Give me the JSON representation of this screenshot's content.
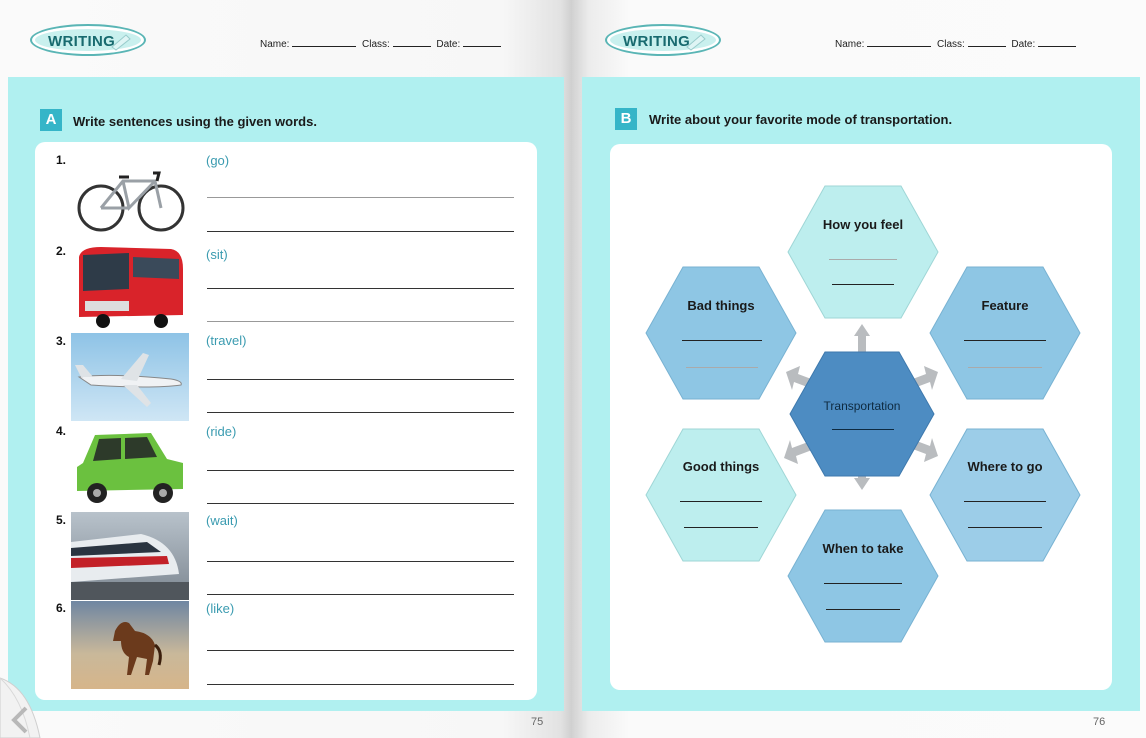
{
  "left_page": {
    "logo": "WRITING",
    "header": {
      "name_label": "Name:",
      "class_label": "Class:",
      "date_label": "Date:"
    },
    "section": {
      "letter": "A",
      "title": "Write sentences using the given words.",
      "items": [
        {
          "num": "1.",
          "word": "(go)",
          "image": "bicycle"
        },
        {
          "num": "2.",
          "word": "(sit)",
          "image": "bus"
        },
        {
          "num": "3.",
          "word": "(travel)",
          "image": "airplane"
        },
        {
          "num": "4.",
          "word": "(ride)",
          "image": "car"
        },
        {
          "num": "5.",
          "word": "(wait)",
          "image": "train"
        },
        {
          "num": "6.",
          "word": "(like)",
          "image": "horse"
        }
      ]
    },
    "page_number": "75"
  },
  "right_page": {
    "logo": "WRITING",
    "header": {
      "name_label": "Name:",
      "class_label": "Class:",
      "date_label": "Date:"
    },
    "section": {
      "letter": "B",
      "title": "Write about your favorite mode of transportation.",
      "diagram": {
        "center": "Transportation",
        "top": "How you feel",
        "top_left": "Bad things",
        "top_right": "Feature",
        "bottom_left": "Good things",
        "bottom_right": "Where to go",
        "bottom": "When to take"
      }
    },
    "page_number": "76"
  },
  "colors": {
    "panel": "#b0f0f0",
    "tag": "#35b5c8",
    "word": "#3a9bb0",
    "hex_light": "#bdeeee",
    "hex_mid": "#8ec6e4",
    "hex_center": "#4d8cc2"
  }
}
